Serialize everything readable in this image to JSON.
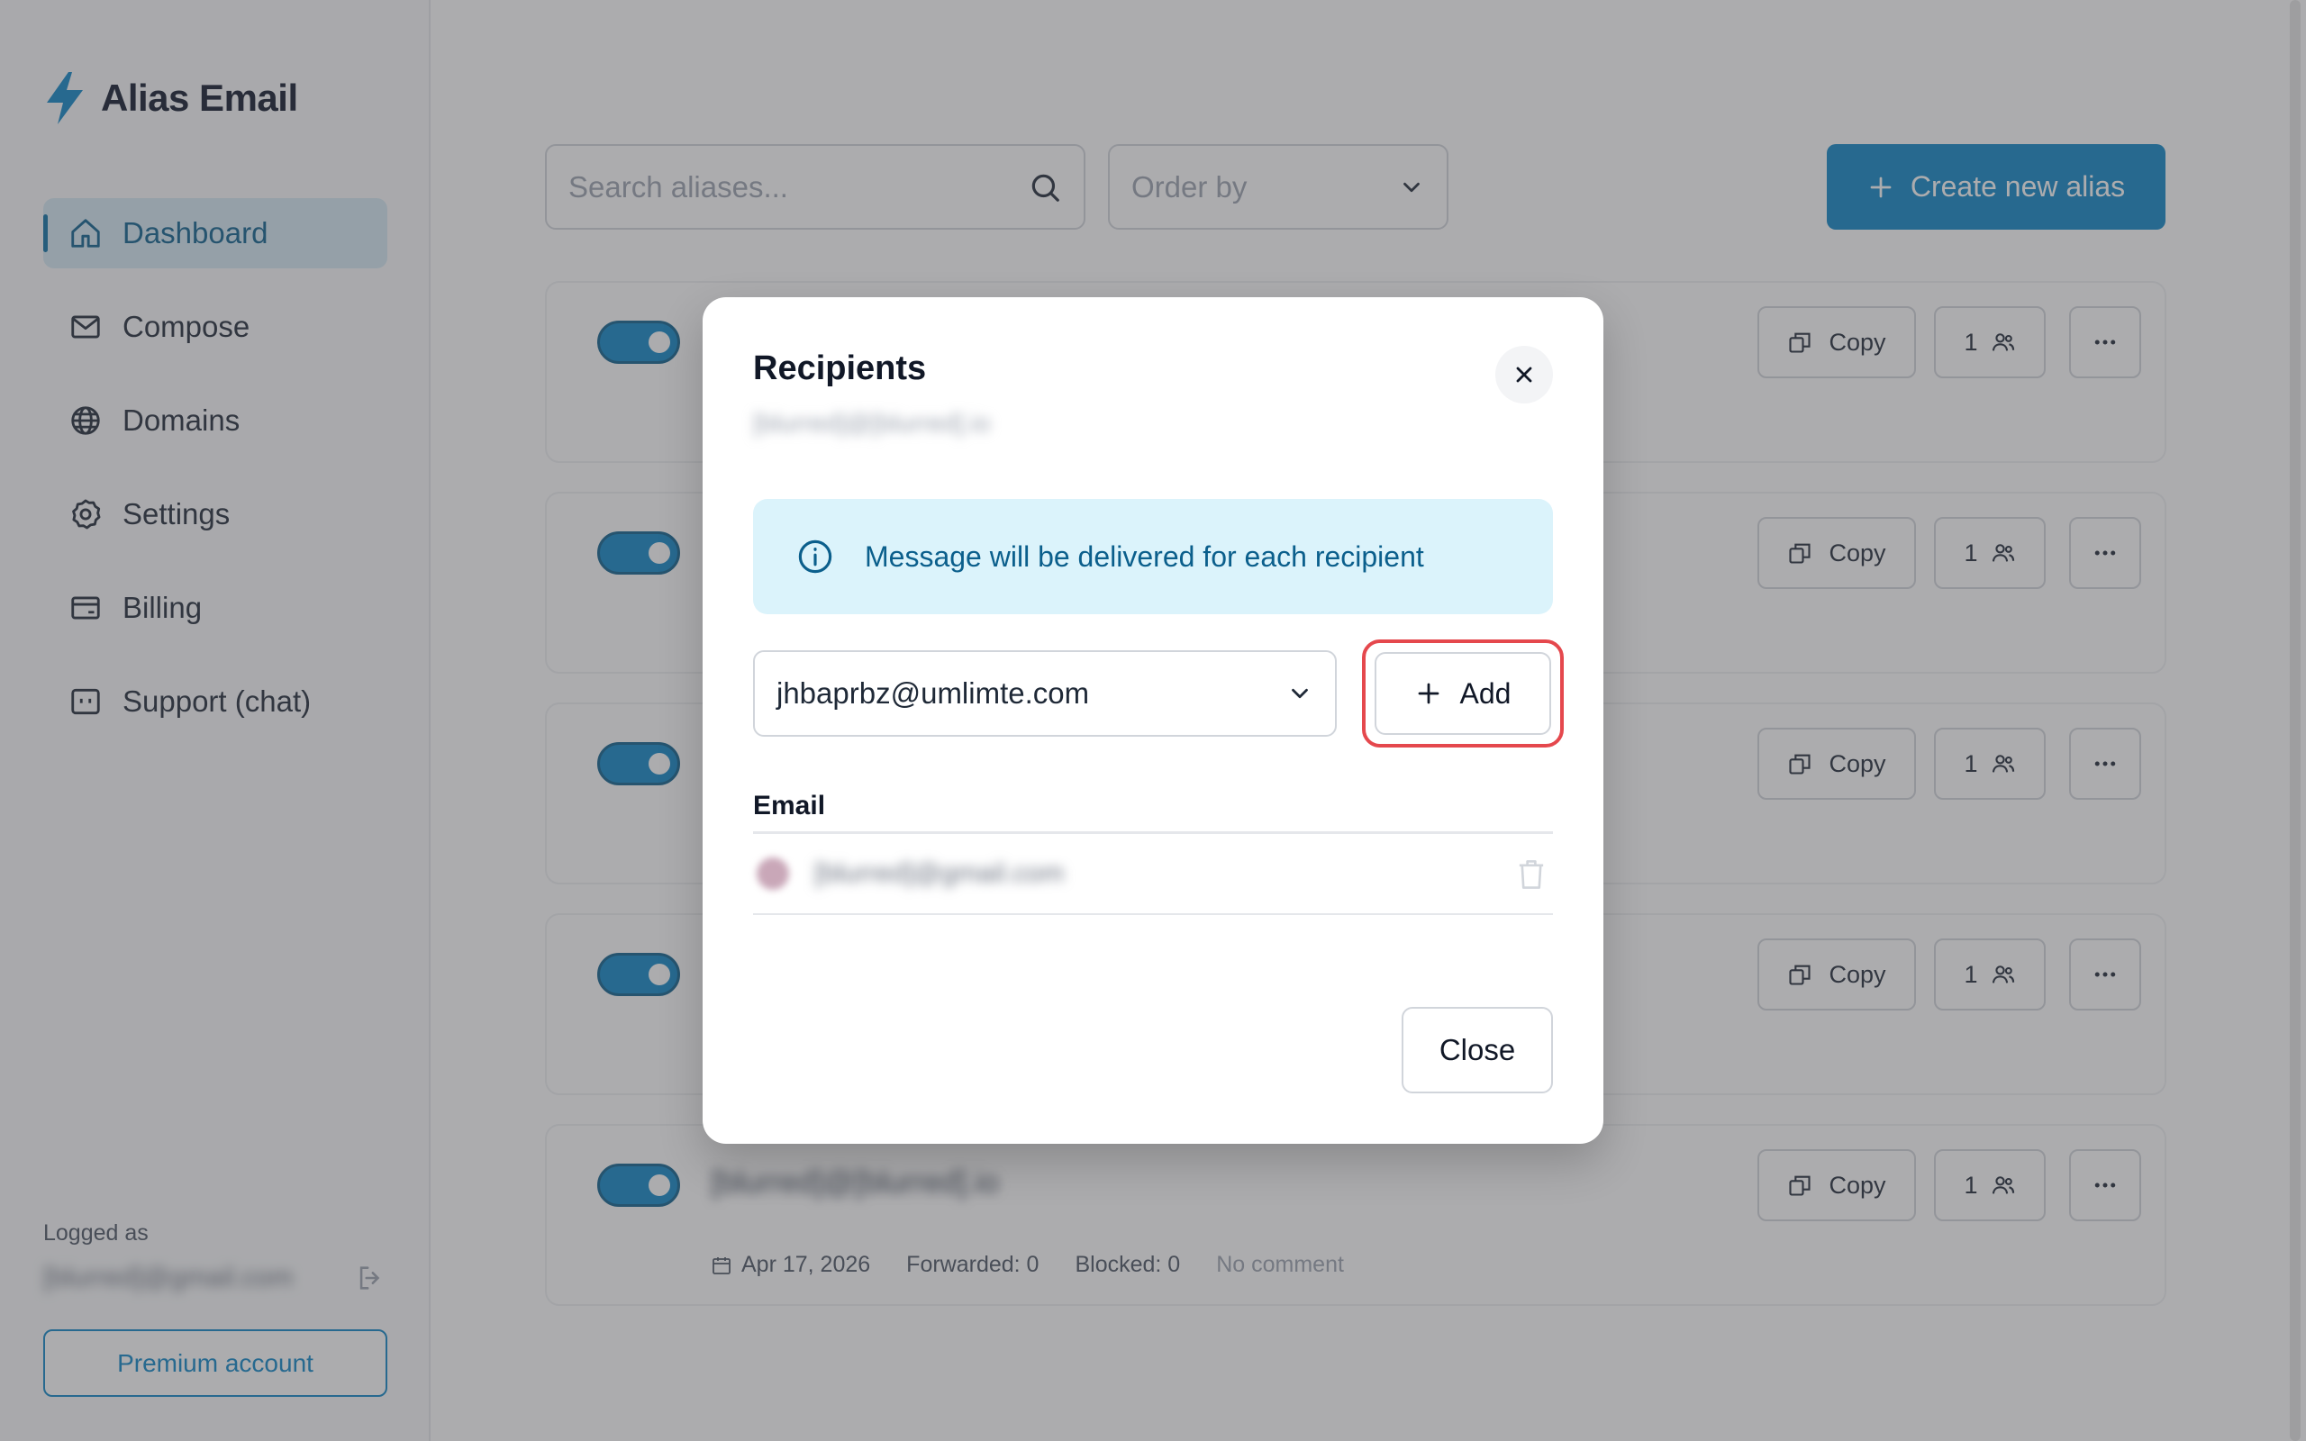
{
  "app": {
    "name": "Alias Email",
    "accent": "#0e86c6"
  },
  "sidebar": {
    "items": [
      {
        "label": "Dashboard",
        "icon": "home-icon",
        "active": true
      },
      {
        "label": "Compose",
        "icon": "mail-icon"
      },
      {
        "label": "Domains",
        "icon": "globe-icon"
      },
      {
        "label": "Settings",
        "icon": "gear-icon"
      },
      {
        "label": "Billing",
        "icon": "card-icon"
      },
      {
        "label": "Support (chat)",
        "icon": "chat-icon"
      }
    ],
    "logged_label": "Logged as",
    "logged_email": "[blurred]@gmail.com",
    "premium_label": "Premium account"
  },
  "toolbar": {
    "search_placeholder": "Search aliases...",
    "order_placeholder": "Order by",
    "create_label": "Create new alias"
  },
  "cards": [
    {
      "copy_label": "Copy",
      "recipients": "1",
      "enabled": true
    },
    {
      "copy_label": "Copy",
      "recipients": "1",
      "enabled": true
    },
    {
      "copy_label": "Copy",
      "recipients": "1",
      "enabled": true
    },
    {
      "copy_label": "Copy",
      "recipients": "1",
      "enabled": true
    },
    {
      "copy_label": "Copy",
      "recipients": "1",
      "enabled": true,
      "alias": "[blurred]@[blurred].io",
      "date": "Apr 17, 2026",
      "forwarded": "Forwarded: 0",
      "blocked": "Blocked: 0",
      "comment": "No comment"
    }
  ],
  "modal": {
    "title": "Recipients",
    "subtitle": "[blurred]@[blurred].io",
    "info": "Message will be delivered for each recipient",
    "select_value": "jhbaprbz@umlimte.com",
    "add_label": "Add",
    "email_header": "Email",
    "email_value": "[blurred]@gmail.com",
    "close_label": "Close"
  }
}
